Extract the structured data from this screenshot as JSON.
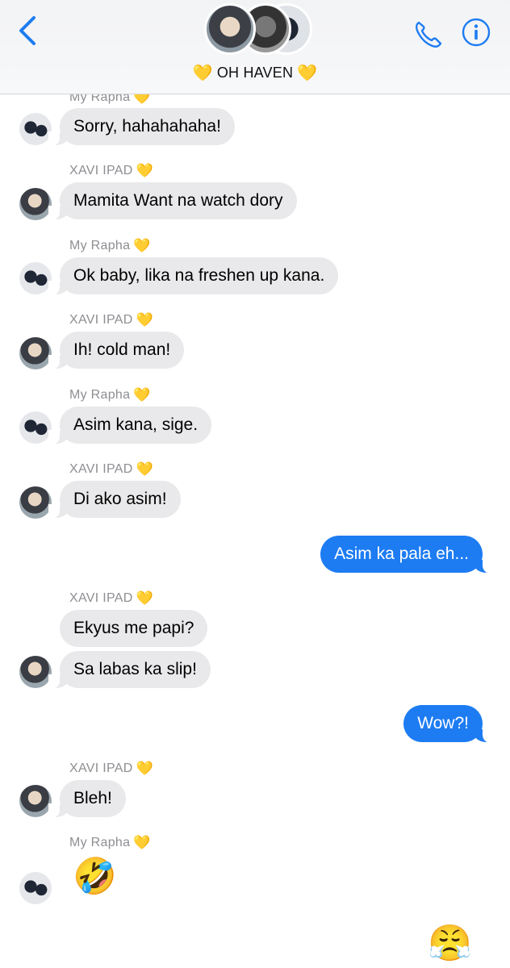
{
  "header": {
    "back_label": "Back",
    "group_name": "OH HAVEN",
    "heart": "💛",
    "call_label": "Call",
    "info_label": "Info"
  },
  "colors": {
    "accent": "#1d7cf2",
    "incoming_bubble": "#e9e9eb",
    "sender_label": "#8e8e93"
  },
  "messages": [
    {
      "sender": "My Rapha",
      "text": "Sorry, hahahahaha!"
    },
    {
      "sender": "XAVI IPAD",
      "text": "Mamita Want na watch dory"
    },
    {
      "sender": "My Rapha",
      "text": "Ok baby, lika na freshen up kana."
    },
    {
      "sender": "XAVI IPAD",
      "text": "Ih! cold man!"
    },
    {
      "sender": "My Rapha",
      "text": "Asim kana, sige."
    },
    {
      "sender": "XAVI IPAD",
      "text": "Di ako asim!"
    },
    {
      "sender": "me",
      "text": "Asim ka pala eh..."
    },
    {
      "sender": "XAVI IPAD",
      "text": "Ekyus me papi?"
    },
    {
      "sender": "XAVI IPAD",
      "text": "Sa labas ka slip!"
    },
    {
      "sender": "me",
      "text": "Wow?!"
    },
    {
      "sender": "XAVI IPAD",
      "text": "Bleh!"
    },
    {
      "sender": "My Rapha",
      "text": "🤣"
    },
    {
      "sender": "me",
      "text": "😤"
    }
  ]
}
